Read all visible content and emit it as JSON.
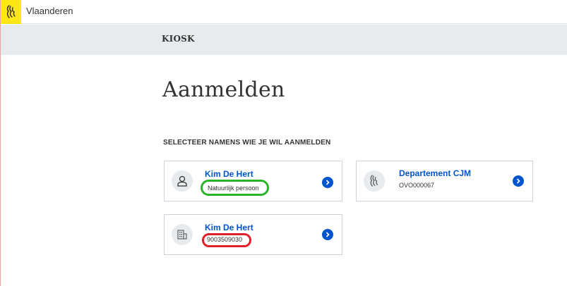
{
  "topbar": {
    "brand": "Vlaanderen",
    "logo_icon": "flemish-lion-icon"
  },
  "header": {
    "title": "KIOSK"
  },
  "main": {
    "title": "Aanmelden",
    "section_label": "SELECTEER NAMENS WIE JE WIL AANMELDEN",
    "cards": [
      {
        "name": "Kim De Hert",
        "subtitle": "Natuurlijk persoon",
        "icon": "person-icon",
        "highlight_color": "#2ab42a"
      },
      {
        "name": "Departement CJM",
        "subtitle": "OVO000067",
        "icon": "flemish-lion-icon"
      },
      {
        "name": "Kim De Hert",
        "subtitle": "9003509030",
        "icon": "building-icon",
        "highlight_color": "#e0202a"
      }
    ]
  },
  "colors": {
    "brand_yellow": "#ffe615",
    "link_blue": "#0055cc",
    "band_gray": "#e8ebee"
  }
}
